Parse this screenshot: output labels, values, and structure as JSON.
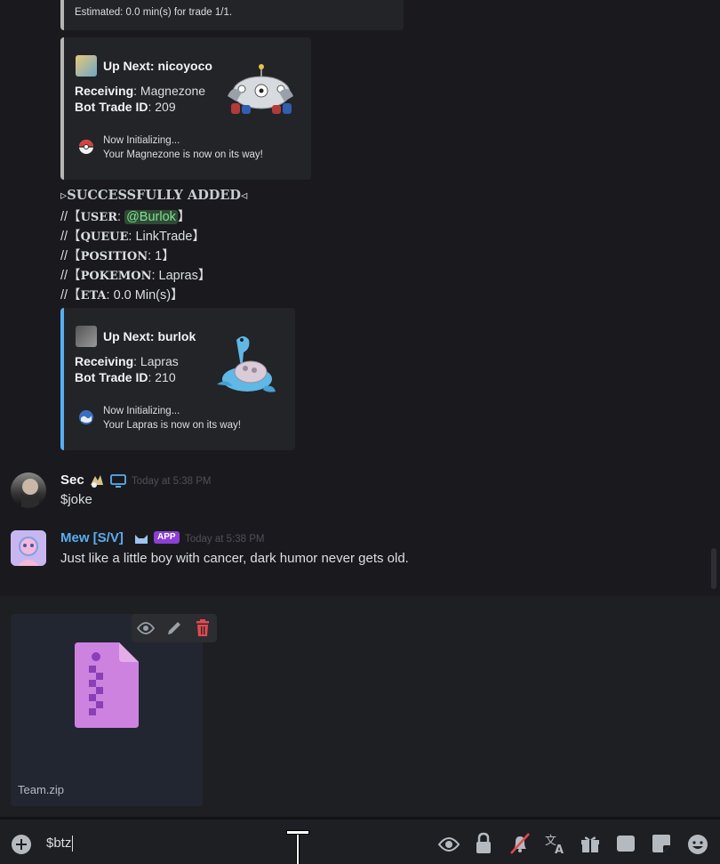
{
  "colors": {
    "background": "#1a1a1e",
    "embed_bg": "#232428",
    "embed_border_gray": "#b5b5b5",
    "embed_border_blue": "#58aef0",
    "username_blue": "#58aef0",
    "app_badge": "#8c3fd6",
    "mention_green": "#7ee08e",
    "delete_red": "#e5484d"
  },
  "top_embed": {
    "footer_text": "Estimated: 0.0 min(s) for trade 1/1."
  },
  "embed1": {
    "title": "Up Next: nicoyoco",
    "receiving_label": "Receiving",
    "receiving_value": ": Magnezone",
    "trade_id_label": "Bot Trade ID",
    "trade_id_value": ": 209",
    "footer_line1": "Now Initializing...",
    "footer_line2": "Your Magnezone is now on its way!",
    "thumbnail_icon": "magnezone-sprite",
    "footer_icon": "pokeball-icon"
  },
  "added_block": {
    "header": "▹SUCCESSFULLY ADDED◃",
    "user_prefix": "//【",
    "user_key": "USER",
    "user_mention": "@Burlok",
    "user_suffix": "】",
    "queue_prefix": "//【",
    "queue_key": "QUEUE",
    "queue_value": ": LinkTrade】",
    "position_prefix": "//【",
    "position_key": "POSITION",
    "position_value": ": 1】",
    "pokemon_prefix": "//【",
    "pokemon_key": "POKEMON",
    "pokemon_value": ": Lapras】",
    "eta_prefix": "//【",
    "eta_key": "ETA",
    "eta_value": ": 0.0 Min(s)】",
    "sep": ":"
  },
  "embed2": {
    "title": "Up Next: burlok",
    "receiving_label": "Receiving",
    "receiving_value": ": Lapras",
    "trade_id_label": "Bot Trade ID",
    "trade_id_value": ": 210",
    "footer_line1": "Now Initializing...",
    "footer_line2": "Your Lapras is now on its way!",
    "thumbnail_icon": "lapras-sprite",
    "footer_icon": "globe-ball-icon"
  },
  "messages": [
    {
      "author": "Sec",
      "time": "Today at 5:38 PM",
      "text": "$joke",
      "name_color": "#f2f3f5"
    },
    {
      "author": "Mew [S/V]",
      "badge": "APP",
      "time": "Today at 5:38 PM",
      "text": "Just like a little boy with cancer, dark humor never gets old.",
      "name_color": "#58aef0"
    }
  ],
  "attachment": {
    "filename": "Team.zip",
    "icon": "zip-file-icon",
    "actions": [
      "eye-icon",
      "pencil-icon",
      "trash-icon"
    ]
  },
  "composer": {
    "value": "$btz",
    "icons": [
      "add-icon",
      "eye-icon",
      "lock-icon",
      "bell-muted-icon",
      "translate-icon",
      "gift-icon",
      "gif-icon",
      "sticker-icon",
      "emoji-icon"
    ]
  }
}
